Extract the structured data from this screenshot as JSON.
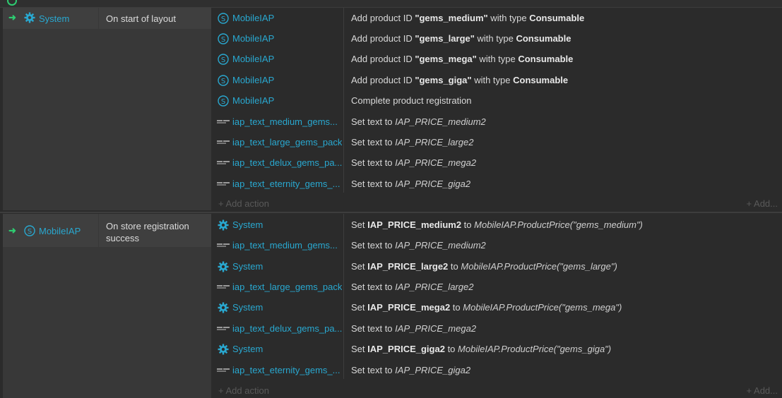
{
  "colors": {
    "accent": "#29a8d0",
    "arrow": "#2ecc71",
    "background": "#2b2b2b",
    "condition_bg": "#3f3f3f"
  },
  "events": [
    {
      "condition": {
        "object": "System",
        "object_icon": "gear-icon",
        "text": "On start of layout"
      },
      "actions": [
        {
          "object": "MobileIAP",
          "icon": "iap-icon",
          "pre": "Add product ID ",
          "b1": "\"gems_medium\"",
          "mid": " with type ",
          "b2": "Consumable"
        },
        {
          "object": "MobileIAP",
          "icon": "iap-icon",
          "pre": "Add product ID ",
          "b1": "\"gems_large\"",
          "mid": " with type ",
          "b2": "Consumable"
        },
        {
          "object": "MobileIAP",
          "icon": "iap-icon",
          "pre": "Add product ID ",
          "b1": "\"gems_mega\"",
          "mid": " with type ",
          "b2": "Consumable"
        },
        {
          "object": "MobileIAP",
          "icon": "iap-icon",
          "pre": "Add product ID ",
          "b1": "\"gems_giga\"",
          "mid": " with type ",
          "b2": "Consumable"
        },
        {
          "object": "MobileIAP",
          "icon": "iap-icon",
          "pre": "Complete product registration"
        },
        {
          "object": "iap_text_medium_gems...",
          "icon": "text-object-icon",
          "pre": "Set text to ",
          "i1": "IAP_PRICE_medium2"
        },
        {
          "object": "iap_text_large_gems_pack",
          "icon": "text-object-icon",
          "pre": "Set text to ",
          "i1": "IAP_PRICE_large2"
        },
        {
          "object": "iap_text_delux_gems_pa...",
          "icon": "text-object-icon",
          "pre": "Set text to ",
          "i1": "IAP_PRICE_mega2"
        },
        {
          "object": "iap_text_eternity_gems_...",
          "icon": "text-object-icon",
          "pre": "Set text to ",
          "i1": "IAP_PRICE_giga2"
        }
      ],
      "add_action": "+ Add action",
      "add_more": "+ Add..."
    },
    {
      "condition": {
        "object": "MobileIAP",
        "object_icon": "iap-icon",
        "text": "On store registration success"
      },
      "actions": [
        {
          "object": "System",
          "icon": "gear-icon",
          "pre": "Set ",
          "b1": "IAP_PRICE_medium2",
          "mid": " to ",
          "i1": "MobileIAP.ProductPrice(\"gems_medium\")"
        },
        {
          "object": "iap_text_medium_gems...",
          "icon": "text-object-icon",
          "pre": "Set text to ",
          "i1": "IAP_PRICE_medium2"
        },
        {
          "object": "System",
          "icon": "gear-icon",
          "pre": "Set ",
          "b1": "IAP_PRICE_large2",
          "mid": " to ",
          "i1": "MobileIAP.ProductPrice(\"gems_large\")"
        },
        {
          "object": "iap_text_large_gems_pack",
          "icon": "text-object-icon",
          "pre": "Set text to ",
          "i1": "IAP_PRICE_large2"
        },
        {
          "object": "System",
          "icon": "gear-icon",
          "pre": "Set ",
          "b1": "IAP_PRICE_mega2",
          "mid": " to ",
          "i1": "MobileIAP.ProductPrice(\"gems_mega\")"
        },
        {
          "object": "iap_text_delux_gems_pa...",
          "icon": "text-object-icon",
          "pre": "Set text to ",
          "i1": "IAP_PRICE_mega2"
        },
        {
          "object": "System",
          "icon": "gear-icon",
          "pre": "Set ",
          "b1": "IAP_PRICE_giga2",
          "mid": " to ",
          "i1": "MobileIAP.ProductPrice(\"gems_giga\")"
        },
        {
          "object": "iap_text_eternity_gems_...",
          "icon": "text-object-icon",
          "pre": "Set text to ",
          "i1": "IAP_PRICE_giga2"
        }
      ],
      "add_action": "+ Add action",
      "add_more": "+ Add..."
    }
  ]
}
